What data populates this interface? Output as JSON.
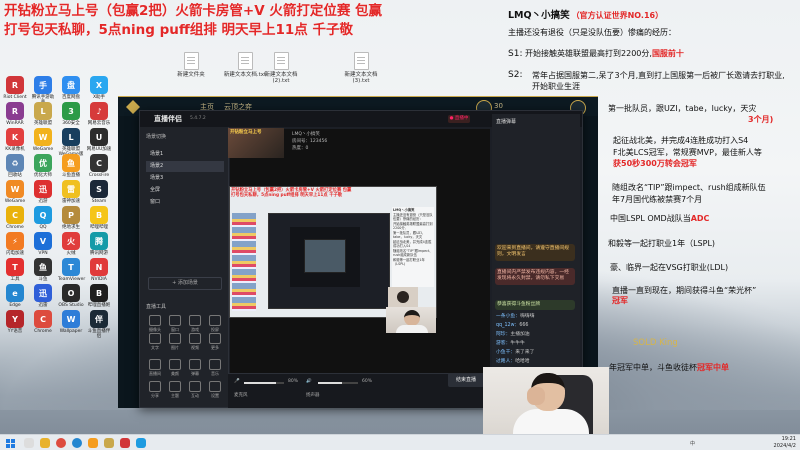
{
  "banner": {
    "line1": "开钻粉立马上号（包赢2把）火箭卡房管+V  火箭打定位赛 包赢",
    "line2": "打号包天私聊，5点ning puff组排   明天早上11点  千子敬"
  },
  "info": {
    "title": "LMQ丶小搞笑",
    "cert": "（官方认证世界NO.16）",
    "subtitle": "主播还没有退役（只是没队伍要）惨痛的经历：",
    "s1_label": "S1:",
    "s1_text": "开始接触英雄联盟最高打到2200分,",
    "s1_hl": "国服前十",
    "s2_label": "S2:",
    "s2_text": "常年占据国服第二,呆了3个月,直到打上国服第一后被厂长邀请去打职业,开始职业生涯",
    "s3_text": "第一批队员，跟UZI，tabe，lucky，天灾",
    "s3_hl": "3个月)",
    "s4_text": "起征战北美，并完成4连胜成功打入S4",
    "s4_text2": "F北美LCS冠军，常规赛MVP，最佳新人等",
    "s4_hl": "获50秒300万转会冠军",
    "s5_text": "随组改名“TIP”跟impect、rush组成新队伍",
    "s5_text2": "年7月国代练被禁赛7个月",
    "s6_text": "中国LSPL OMD战队当",
    "s6_hl": "ADC",
    "s7_text": "和毅等一起打职业1年（LSPL)",
    "s8_text": "豪、临界一起在VSG打职业(LDL)",
    "s9_text": "直播一直到现在，期间获得斗鱼“荣光杯”",
    "s9_hl": "冠军",
    "king": "SOLD King",
    "last_text": "年冠军中单，斗鱼收徒杯",
    "last_hl": "冠军中单"
  },
  "desktop_files": [
    {
      "label": "新建文件夹"
    },
    {
      "label": "新建文本文档.txt"
    },
    {
      "label": "新建文本文档(2).txt"
    },
    {
      "label": "新建文本文档(3).txt"
    }
  ],
  "desktop_icons": [
    {
      "label": "Riot Client",
      "color": "#d13639",
      "glyph": "R"
    },
    {
      "label": "腾讯手游助手",
      "color": "#2d7ee8",
      "glyph": "手"
    },
    {
      "label": "百度网盘",
      "color": "#2f8ff0",
      "glyph": "盘"
    },
    {
      "label": "X助手",
      "color": "#2aa7f0",
      "glyph": "X"
    },
    {
      "label": "WinRAR",
      "color": "#8a3d91",
      "glyph": "R"
    },
    {
      "label": "英雄联盟",
      "color": "#c9a84c",
      "glyph": "L"
    },
    {
      "label": "360安全",
      "color": "#2c9b47",
      "glyph": "3"
    },
    {
      "label": "网易云音乐",
      "color": "#d63b3b",
      "glyph": "♪"
    },
    {
      "label": "KK录像机",
      "color": "#e23f3f",
      "glyph": "K"
    },
    {
      "label": "WeGame",
      "color": "#f2b21c",
      "glyph": "W"
    },
    {
      "label": "英雄联盟WeGame版",
      "color": "#183e5e",
      "glyph": "L"
    },
    {
      "label": "网易UU加速",
      "color": "#2d2d2d",
      "glyph": "U"
    },
    {
      "label": "回收站",
      "color": "#5e86b5",
      "glyph": "♻"
    },
    {
      "label": "优化大师",
      "color": "#3ca55c",
      "glyph": "优"
    },
    {
      "label": "斗鱼直播",
      "color": "#f59d1f",
      "glyph": "鱼"
    },
    {
      "label": "CrossFire",
      "color": "#333333",
      "glyph": "C"
    },
    {
      "label": "WeGame",
      "color": "#f08a24",
      "glyph": "W"
    },
    {
      "label": "迅游",
      "color": "#dd3030",
      "glyph": "迅"
    },
    {
      "label": "雷神加速",
      "color": "#f0c020",
      "glyph": "雷"
    },
    {
      "label": "Steam",
      "color": "#1b2838",
      "glyph": "S"
    },
    {
      "label": "Chrome",
      "color": "#e9b20c",
      "glyph": "C"
    },
    {
      "label": "QQ",
      "color": "#1e9be0",
      "glyph": "Q"
    },
    {
      "label": "绝地求生",
      "color": "#b58b3c",
      "glyph": "P"
    },
    {
      "label": "哔哩哔哩",
      "color": "#f5c518",
      "glyph": "B"
    },
    {
      "label": "闪电加速",
      "color": "#f27a22",
      "glyph": "⚡"
    },
    {
      "label": "VPN",
      "color": "#1d6fd8",
      "glyph": "V"
    },
    {
      "label": "火绒",
      "color": "#e03c3c",
      "glyph": "火"
    },
    {
      "label": "腾讯网游",
      "color": "#159ba8",
      "glyph": "腾"
    },
    {
      "label": "工具",
      "color": "#e33030",
      "glyph": "T"
    },
    {
      "label": "斗鱼",
      "color": "#333333",
      "glyph": "鱼"
    },
    {
      "label": "TeamViewer",
      "color": "#2c88d6",
      "glyph": "T"
    },
    {
      "label": "NVIDIA",
      "color": "#e03a3a",
      "glyph": "N"
    },
    {
      "label": "Edge",
      "color": "#2486d0",
      "glyph": "e"
    },
    {
      "label": "迅雷",
      "color": "#2f5fd8",
      "glyph": "迅"
    },
    {
      "label": "OBS Studio",
      "color": "#2a2a2a",
      "glyph": "O"
    },
    {
      "label": "哔哩直播姬",
      "color": "#1e1e1e",
      "glyph": "B"
    },
    {
      "label": "YY语音",
      "color": "#b5262a",
      "glyph": "Y"
    },
    {
      "label": "Chrome",
      "color": "#dd4b3e",
      "glyph": "C"
    },
    {
      "label": "Wallpaper",
      "color": "#2e7dd8",
      "glyph": "W"
    },
    {
      "label": "斗鱼直播伴侣",
      "color": "#1b2a36",
      "glyph": "伴"
    }
  ],
  "lol_client": {
    "nav_home": "主页",
    "nav_cloud": "云顶之弈",
    "level": "30"
  },
  "app": {
    "name": "直播伴侣",
    "version": "5.4.7.2",
    "rec": "● 直播中",
    "scene_label": "场景切换",
    "scenes": [
      "场景1",
      "场景2",
      "场景3",
      "全屏",
      "窗口"
    ],
    "add_scene": "+ 添加场景",
    "tools_top": [
      "摄像头",
      "窗口",
      "游戏",
      "投屏"
    ],
    "tools_bottom": [
      "文字",
      "图片",
      "视频",
      "更多"
    ],
    "tools_bottom2": [
      "直播间",
      "美颜",
      "弹幕",
      "音乐"
    ],
    "tools_bottom3": [
      "分享",
      "主题",
      "互动",
      "设置"
    ],
    "more_tools": "直播工具",
    "golive": "结束直播",
    "mic_label": "麦克风",
    "speaker_label": "扬声器",
    "mic_value": "80%",
    "speaker_value": "60%"
  },
  "streamer_card": {
    "badge": "开钻粉立马上号",
    "name": "LMQ丶小搞笑",
    "room": "房间号：123456",
    "hot": "热度：0"
  },
  "danmu": {
    "tab": "直播弹幕",
    "notice1": "欢迎来到直播间，请遵守直播间规则，文明发言",
    "notice2": "直播间内严禁发布违规内容，一经发现将永久封禁，请勿私下交易",
    "notice3": "恭喜获得斗鱼粉丝牌",
    "msgs": [
      {
        "user": "一条小鱼：",
        "text": "嗨嗨嗨"
      },
      {
        "user": "qq_12w：",
        "text": "666"
      },
      {
        "user": "阿珍：",
        "text": "主播加油"
      },
      {
        "user": "游客：",
        "text": "牛牛牛"
      },
      {
        "user": "小鱼干：",
        "text": "来了来了"
      },
      {
        "user": "过路人：",
        "text": "哈哈哈"
      }
    ],
    "input_placeholder": "和主播说点什么...",
    "send": "发送"
  },
  "taskbar": {
    "time": "19:21",
    "date": "2024/4/2",
    "lang": "中"
  },
  "colors": {
    "banner_red": "#e32828",
    "lol_gold": "#c9a84c",
    "douyu_orange": "#f59d1f"
  }
}
